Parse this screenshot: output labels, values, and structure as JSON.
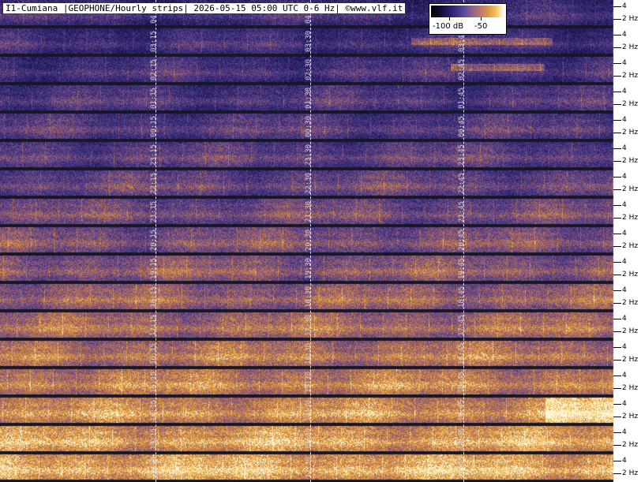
{
  "title": "I1-Cumiana |GEOPHONE/Hourly strips| 2026-05-15 05:00 UTC 0-6 Hz| ©www.vlf.it",
  "colorbar": {
    "labels": [
      "-100 dB",
      "-50"
    ]
  },
  "chart_data": {
    "type": "heatmap",
    "title": "I1-Cumiana |GEOPHONE/Hourly strips| 2026-05-15 05:00 UTC 0-6 Hz| ©www.vlf.it",
    "y_tick_labels": [
      "4",
      "2 Hz"
    ],
    "colorbar_labels": [
      "-100 dB",
      "-50"
    ],
    "strips": [
      {
        "times": [
          "04:15",
          "04:30",
          ""
        ]
      },
      {
        "times": [
          "03:15",
          "03:30",
          "03:45"
        ]
      },
      {
        "times": [
          "02:15",
          "02:30",
          "02:45"
        ]
      },
      {
        "times": [
          "01:15",
          "01:30",
          "01:45"
        ]
      },
      {
        "times": [
          "00:15",
          "00:30",
          "00:45"
        ]
      },
      {
        "times": [
          "23:15",
          "23:30",
          "23:45"
        ]
      },
      {
        "times": [
          "22:15",
          "22:30",
          "22:45"
        ]
      },
      {
        "times": [
          "21:15",
          "21:30",
          "21:45"
        ]
      },
      {
        "times": [
          "20:15",
          "20:30",
          "20:45"
        ]
      },
      {
        "times": [
          "19:15",
          "19:30",
          "19:45"
        ]
      },
      {
        "times": [
          "18:15",
          "18:30",
          "18:45"
        ]
      },
      {
        "times": [
          "17:15",
          "17:30",
          "17:45"
        ]
      },
      {
        "times": [
          "16:15",
          "16:30",
          "16:45"
        ]
      },
      {
        "times": [
          "15:15",
          "15:30",
          "15:45"
        ]
      },
      {
        "times": [
          "14:15",
          "14:30",
          "14:45"
        ]
      },
      {
        "times": [
          "13:15",
          "13:30",
          "13:45"
        ]
      },
      {
        "times": [
          "12:15",
          "12:30",
          "12:45"
        ]
      }
    ]
  }
}
